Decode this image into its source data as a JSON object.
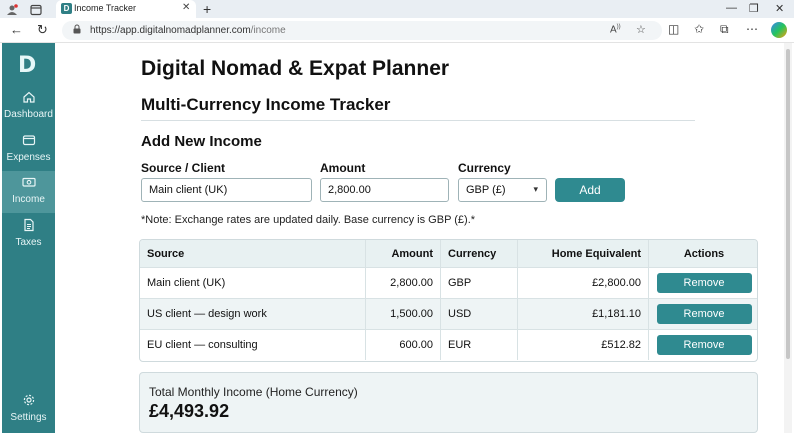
{
  "browser": {
    "tab_title": "Income Tracker",
    "favicon_letter": "D",
    "url_host": "https://app.digitalnomadplanner.com",
    "url_path": "/income",
    "icons": [
      "back-icon",
      "refresh-icon",
      "lock-icon",
      "read-aloud-icon",
      "favorite-icon",
      "split-screen-icon",
      "favorites-icon",
      "collections-icon",
      "more-icon",
      "copilot-icon"
    ]
  },
  "sidebar": {
    "logo": "D",
    "items": [
      {
        "label": "Dashboard",
        "icon": "home-icon"
      },
      {
        "label": "Expenses",
        "icon": "wallet-icon"
      },
      {
        "label": "Income",
        "icon": "money-icon"
      },
      {
        "label": "Taxes",
        "icon": "document-icon"
      }
    ],
    "settings": {
      "label": "Settings",
      "icon": "gear-icon"
    }
  },
  "page": {
    "title": "Digital Nomad & Expat Planner",
    "subtitle": "Multi-Currency Income Tracker",
    "form_title": "Add New Income"
  },
  "form": {
    "source_label": "Source / Client",
    "source_value": "Main client (UK)",
    "amount_label": "Amount",
    "amount_value": "2,800.00",
    "currency_label": "Currency",
    "currency_value": "GBP (£)",
    "add_button": "Add",
    "note": "*Note: Exchange rates are updated daily. Base currency is GBP (£).*"
  },
  "table": {
    "headers": [
      "Source",
      "Amount",
      "Currency",
      "Home Equivalent",
      "Actions"
    ],
    "rows": [
      {
        "source": "Main client (UK)",
        "amount": "2,800.00",
        "currency": "GBP",
        "home": "£2,800.00",
        "action": "Remove"
      },
      {
        "source": "US client — design work",
        "amount": "1,500.00",
        "currency": "USD",
        "home": "£1,181.10",
        "action": "Remove"
      },
      {
        "source": "EU client — consulting",
        "amount": "600.00",
        "currency": "EUR",
        "home": "£512.82",
        "action": "Remove"
      }
    ]
  },
  "total": {
    "label": "Total Monthly Income (Home Currency)",
    "value": "£4,493.92"
  }
}
